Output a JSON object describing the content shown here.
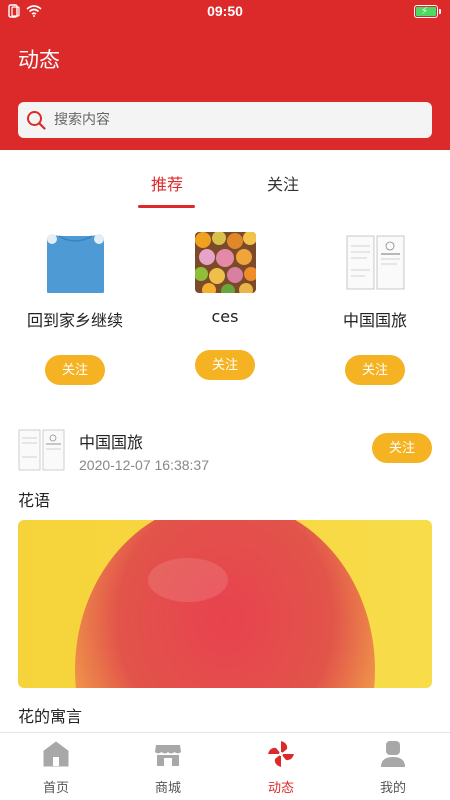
{
  "status_bar": {
    "time": "09:50"
  },
  "header": {
    "title": "动态"
  },
  "search": {
    "placeholder": "搜索内容"
  },
  "tabs": [
    {
      "label": "推荐",
      "active": true
    },
    {
      "label": "关注",
      "active": false
    }
  ],
  "recommended_users": [
    {
      "name": "回到家乡继续",
      "avatar": "blue-smock-image",
      "follow_label": "关注"
    },
    {
      "name": "ces",
      "avatar": "fruit-pile-image",
      "follow_label": "关注"
    },
    {
      "name": "中国国旅",
      "avatar": "document-scan-image",
      "follow_label": "关注"
    }
  ],
  "post": {
    "author": "中国国旅",
    "time": "2020-12-07 16:38:37",
    "follow_label": "关注",
    "title": "花语",
    "image": "red-apple-on-yellow-image",
    "caption": "花的寓言"
  },
  "bottom_nav": [
    {
      "label": "首页",
      "icon": "home-icon",
      "active": false
    },
    {
      "label": "商城",
      "icon": "store-icon",
      "active": false
    },
    {
      "label": "动态",
      "icon": "pinwheel-icon",
      "active": true
    },
    {
      "label": "我的",
      "icon": "user-icon",
      "active": false
    }
  ],
  "colors": {
    "brand_red": "#dc2a2b",
    "follow_yellow": "#f5b323",
    "battery_green": "#4cd964"
  }
}
